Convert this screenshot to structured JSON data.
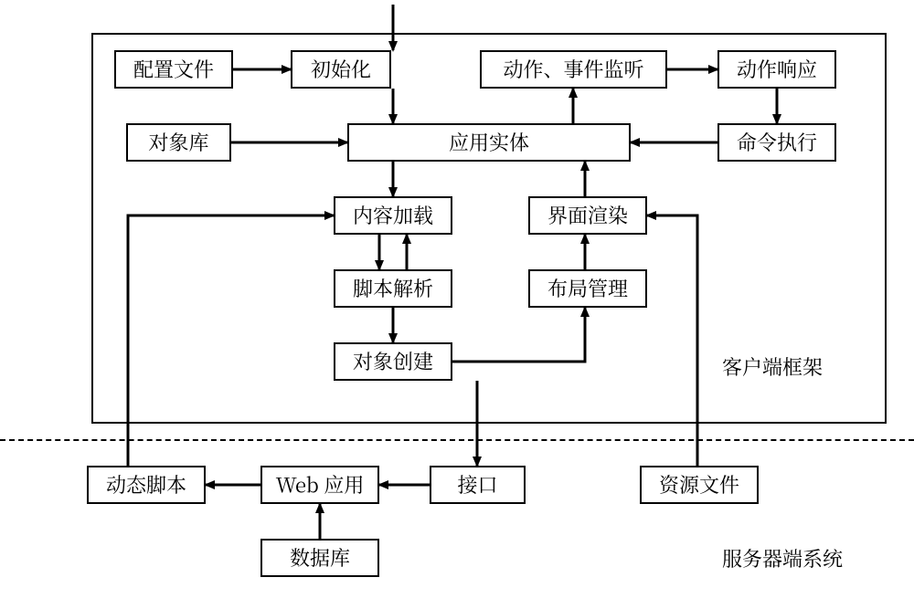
{
  "labels": {
    "config_file": "配置文件",
    "init": "初始化",
    "action_listen": "动作、事件监听",
    "action_response": "动作响应",
    "object_lib": "对象库",
    "app_entity": "应用实体",
    "cmd_exec": "命令执行",
    "content_load": "内容加载",
    "ui_render": "界面渲染",
    "script_parse": "脚本解析",
    "layout_mgmt": "布局管理",
    "obj_create": "对象创建",
    "dyn_script": "动态脚本",
    "web_app": "Web 应用",
    "interface": "接口",
    "res_file": "资源文件",
    "database": "数据库",
    "client_frame": "客户端框架",
    "server_system": "服务器端系统"
  }
}
